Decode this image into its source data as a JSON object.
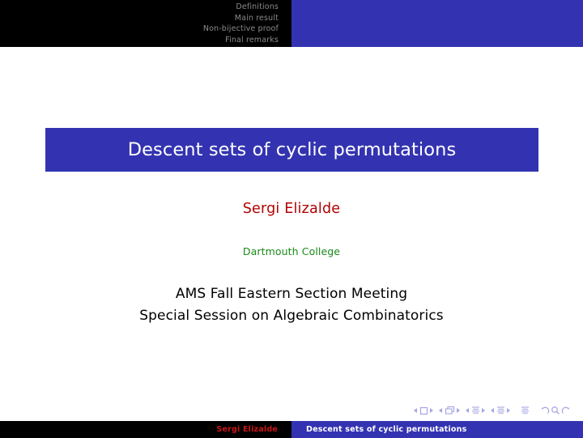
{
  "header": {
    "nav_items": [
      {
        "label": "Definitions"
      },
      {
        "label": "Main result"
      },
      {
        "label": "Non-bijective proof"
      },
      {
        "label": "Final remarks"
      }
    ],
    "left_bg": "#000000",
    "right_bg": "#3333b2",
    "text_color": "#8a8a8a"
  },
  "slide": {
    "title": "Descent sets of cyclic permutations",
    "title_box_bg": "#3333b2",
    "title_text_color": "#ffffff",
    "author": "Sergi Elizalde",
    "author_color": "#b00000",
    "institute": "Dartmouth College",
    "institute_color": "#1a8a1a",
    "event_line_1": "AMS Fall Eastern Section Meeting",
    "event_line_2": "Special Session on Algebraic Combinatorics",
    "event_color": "#000000"
  },
  "nav_symbols": {
    "slide_icon": "slide-navigation-icon",
    "frame_icon": "frame-navigation-icon",
    "subsection_icon": "subsection-navigation-icon",
    "section_icon": "section-navigation-icon",
    "document_icon": "document-navigation-icon",
    "back_icon": "go-back-icon",
    "search_icon": "search-icon",
    "forward_icon": "go-forward-icon",
    "color": "#5a5ad0"
  },
  "footer": {
    "author": "Sergi Elizalde",
    "author_color": "#cc1414",
    "title": "Descent sets of cyclic permutations",
    "title_color": "#ffffff",
    "left_bg": "#000000",
    "right_bg": "#3333b2"
  }
}
